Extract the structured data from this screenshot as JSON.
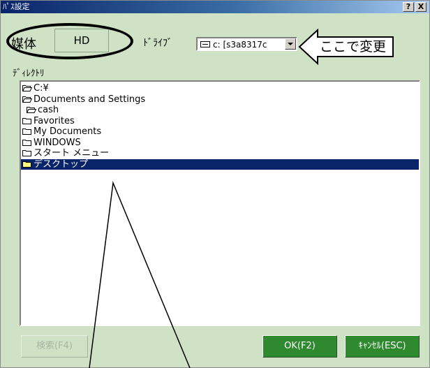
{
  "window": {
    "title": "ﾊﾟｽ設定",
    "help_button": "?",
    "close_button": "X"
  },
  "media": {
    "label": "媒体",
    "value": "HD"
  },
  "drive": {
    "label": "ﾄﾞﾗｲﾌﾞ",
    "selected": "c: [s3a8317c"
  },
  "callout": {
    "text": "ここで変更"
  },
  "directory": {
    "label": "ﾃﾞｨﾚｸﾄﾘ",
    "items": [
      {
        "label": "C:¥",
        "icon": "open-folder-icon",
        "selected": false
      },
      {
        "label": "Documents and Settings",
        "icon": "open-folder-icon",
        "selected": false
      },
      {
        "label": "cash",
        "icon": "open-folder-icon",
        "selected": false
      },
      {
        "label": "Favorites",
        "icon": "folder-icon",
        "selected": false
      },
      {
        "label": "My Documents",
        "icon": "folder-icon",
        "selected": false
      },
      {
        "label": "WINDOWS",
        "icon": "folder-icon",
        "selected": false
      },
      {
        "label": "スタート メニュー",
        "icon": "folder-icon",
        "selected": false
      },
      {
        "label": "デスクトップ",
        "icon": "folder-icon",
        "selected": true
      }
    ]
  },
  "buttons": {
    "search": "検索(F4)",
    "ok": "OK(F2)",
    "cancel": "ｷｬﾝｾﾙ(ESC)"
  },
  "colors": {
    "dialog_background": "#cfe2c6",
    "button_green": "#2f8a2f",
    "selection": "#0a246a"
  }
}
